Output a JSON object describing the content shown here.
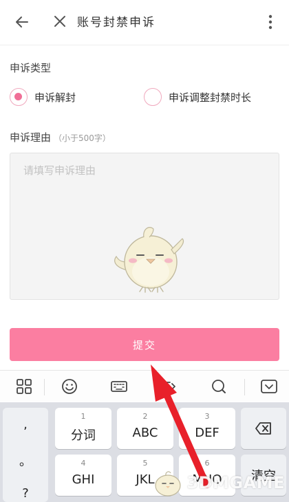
{
  "header": {
    "title": "账号封禁申诉"
  },
  "appeal_type": {
    "label": "申诉类型",
    "options": [
      {
        "label": "申诉解封",
        "checked": true
      },
      {
        "label": "申诉调整封禁时长",
        "checked": false
      }
    ]
  },
  "reason": {
    "label": "申诉理由",
    "hint": "（小于500字）",
    "placeholder": "请填写申诉理由"
  },
  "submit_label": "提交",
  "keyboard": {
    "punct": [
      ",",
      "。",
      "?"
    ],
    "row1": [
      {
        "num": "",
        "label": "分词"
      },
      {
        "num": "2",
        "label": "ABC"
      },
      {
        "num": "3",
        "label": "DEF"
      }
    ],
    "row1_num": [
      "1",
      "2",
      "3"
    ],
    "row2": [
      {
        "num": "4",
        "label": "GHI"
      },
      {
        "num": "5",
        "label": "JKL"
      },
      {
        "num": "6",
        "label": "MNO"
      }
    ],
    "clear_label": "清空"
  },
  "watermark": "3DMGAME",
  "colors": {
    "accent": "#fb7ea1",
    "radio_checked": "#f06f97",
    "arrow": "#e8202a"
  }
}
